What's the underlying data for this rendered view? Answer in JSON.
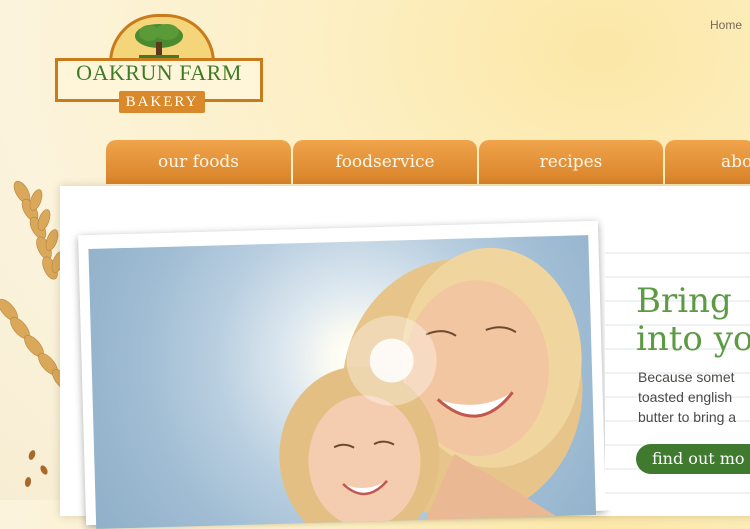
{
  "header": {
    "util_link": "Home",
    "logo": {
      "name": "OAKRUN FARM",
      "sub": "BAKERY"
    }
  },
  "nav": {
    "items": [
      {
        "label": "our foods"
      },
      {
        "label": "foodservice"
      },
      {
        "label": "recipes"
      },
      {
        "label": "abo"
      }
    ]
  },
  "hero": {
    "headline_line1": "Bring",
    "headline_line2": "into yo",
    "body_line1": "Because somet",
    "body_line2": "toasted english",
    "body_line3": "butter to bring a",
    "cta_label": "find out mo"
  },
  "colors": {
    "nav_orange": "#e48f33",
    "brand_green": "#3f7a2e",
    "headline_green": "#5c9a44",
    "logo_border": "#c97a1b"
  }
}
